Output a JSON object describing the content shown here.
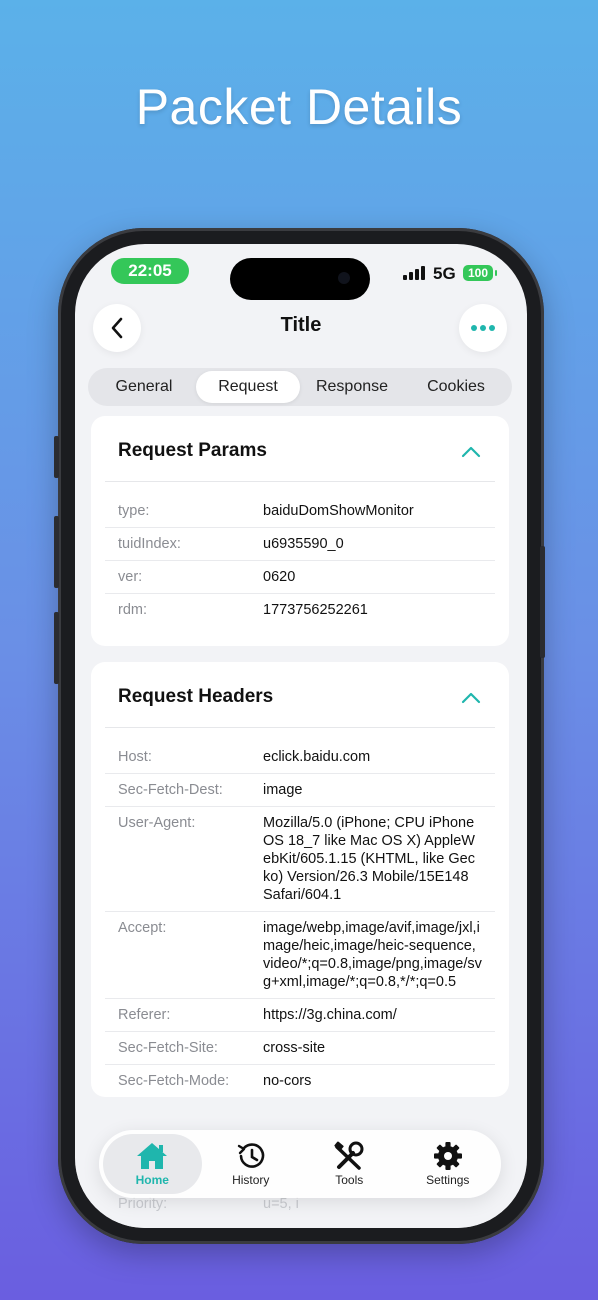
{
  "headline": "Packet Details",
  "status_bar": {
    "time": "22:05",
    "network": "5G",
    "battery": "100"
  },
  "nav": {
    "title": "Title"
  },
  "tabs": [
    {
      "label": "General"
    },
    {
      "label": "Request"
    },
    {
      "label": "Response"
    },
    {
      "label": "Cookies"
    }
  ],
  "request_params": {
    "title": "Request Params",
    "rows": [
      {
        "key": "type:",
        "value": "baiduDomShowMonitor"
      },
      {
        "key": "tuidIndex:",
        "value": "u6935590_0"
      },
      {
        "key": "ver:",
        "value": "0620"
      },
      {
        "key": "rdm:",
        "value": "1773756252261"
      }
    ]
  },
  "request_headers": {
    "title": "Request Headers",
    "rows": [
      {
        "key": "Host:",
        "value": "eclick.baidu.com"
      },
      {
        "key": "Sec-Fetch-Dest:",
        "value": "image"
      },
      {
        "key": "User-Agent:",
        "value": "Mozilla/5.0 (iPhone; CPU iPhone OS 18_7 like Mac OS X) AppleWebKit/605.1.15 (KHTML, like Gecko) Version/26.3 Mobile/15E148 Safari/604.1"
      },
      {
        "key": "Accept:",
        "value": "image/webp,image/avif,image/jxl,image/heic,image/heic-sequence,video/*;q=0.8,image/png,image/svg+xml,image/*;q=0.8,*/*;q=0.5"
      },
      {
        "key": "Referer:",
        "value": "https://3g.china.com/"
      },
      {
        "key": "Sec-Fetch-Site:",
        "value": "cross-site"
      },
      {
        "key": "Sec-Fetch-Mode:",
        "value": "no-cors"
      }
    ],
    "partial_row": {
      "key": "Priority:",
      "value": "u=5, i"
    }
  },
  "tabbar": [
    {
      "label": "Home",
      "icon": "home-icon"
    },
    {
      "label": "History",
      "icon": "history-icon"
    },
    {
      "label": "Tools",
      "icon": "tools-icon"
    },
    {
      "label": "Settings",
      "icon": "gear-icon"
    }
  ],
  "colors": {
    "accent": "#1fb6ad",
    "status_green": "#34c759",
    "bg_top": "#5bb1e9",
    "bg_bottom": "#6a5ee0"
  }
}
